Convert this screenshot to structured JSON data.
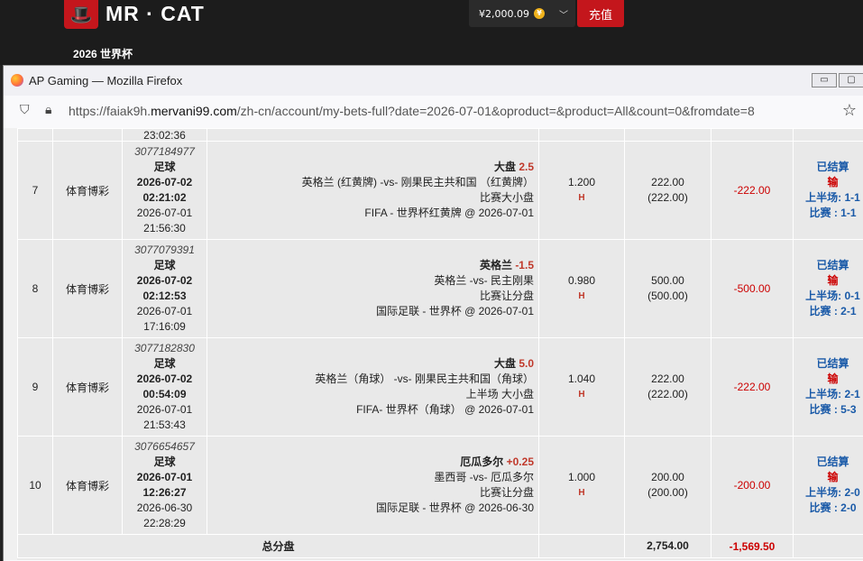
{
  "site": {
    "brand": "MR · CAT",
    "subnav": "2026 世界杯",
    "balance": "¥2,000.09",
    "coin_glyph": "¥",
    "deposit_label": "充值"
  },
  "browser": {
    "title": "AP Gaming — Mozilla Firefox",
    "url_prefix": "https://faiak9h.",
    "url_domain": "mervani99.com",
    "url_rest": "/zh-cn/account/my-bets-full?date=2026-07-01&oproduct=&product=All&count=0&fromdate=8"
  },
  "bets": {
    "prev_time_fragment": "23:02:36",
    "rows": [
      {
        "num": "7",
        "product": "体育博彩",
        "bet_id": "3077184977",
        "sport": "足球",
        "kick_date": "2026-07-02",
        "kick_time": "02:21:02",
        "place_date": "2026-07-01",
        "place_time": "21:56:30",
        "selection": "大盘",
        "handicap": "2.5",
        "match": "英格兰 (红黄牌) -vs- 刚果民主共和国 （红黄牌）",
        "market": "比赛大小盘",
        "league": "FIFA - 世界杯红黄牌 @ 2026-07-01",
        "odds": "1.200",
        "odds_type": "H",
        "stake": "222.00",
        "stake_paren": "(222.00)",
        "winloss": "-222.00",
        "status": "已结算",
        "result": "输",
        "half": "上半场: 1-1",
        "full": "比赛 : 1-1"
      },
      {
        "num": "8",
        "product": "体育博彩",
        "bet_id": "3077079391",
        "sport": "足球",
        "kick_date": "2026-07-02",
        "kick_time": "02:12:53",
        "place_date": "2026-07-01",
        "place_time": "17:16:09",
        "selection": "英格兰",
        "handicap": "-1.5",
        "match": "英格兰 -vs- 民主刚果",
        "market": "比赛让分盘",
        "league": "国际足联 - 世界杯 @ 2026-07-01",
        "odds": "0.980",
        "odds_type": "H",
        "stake": "500.00",
        "stake_paren": "(500.00)",
        "winloss": "-500.00",
        "status": "已结算",
        "result": "输",
        "half": "上半场: 0-1",
        "full": "比赛 : 2-1"
      },
      {
        "num": "9",
        "product": "体育博彩",
        "bet_id": "3077182830",
        "sport": "足球",
        "kick_date": "2026-07-02",
        "kick_time": "00:54:09",
        "place_date": "2026-07-01",
        "place_time": "21:53:43",
        "selection": "大盘",
        "handicap": "5.0",
        "match": "英格兰（角球） -vs- 刚果民主共和国（角球）",
        "market": "上半场 大小盘",
        "league": "FIFA- 世界杯（角球） @ 2026-07-01",
        "odds": "1.040",
        "odds_type": "H",
        "stake": "222.00",
        "stake_paren": "(222.00)",
        "winloss": "-222.00",
        "status": "已结算",
        "result": "输",
        "half": "上半场: 2-1",
        "full": "比赛 : 5-3"
      },
      {
        "num": "10",
        "product": "体育博彩",
        "bet_id": "3076654657",
        "sport": "足球",
        "kick_date": "2026-07-01",
        "kick_time": "12:26:27",
        "place_date": "2026-06-30",
        "place_time": "22:28:29",
        "selection": "厄瓜多尔",
        "handicap": "+0.25",
        "match": "墨西哥 -vs- 厄瓜多尔",
        "market": "比赛让分盘",
        "league": "国际足联 - 世界杯 @ 2026-06-30",
        "odds": "1.000",
        "odds_type": "H",
        "stake": "200.00",
        "stake_paren": "(200.00)",
        "winloss": "-200.00",
        "status": "已结算",
        "result": "输",
        "half": "上半场: 2-0",
        "full": "比赛 : 2-0"
      }
    ],
    "total": {
      "label": "总分盘",
      "stake": "2,754.00",
      "winloss": "-1,569.50"
    }
  },
  "colors": {
    "brand_red": "#c4161c",
    "loss_red": "#cc0000",
    "status_blue": "#1a5aa8",
    "handicap_red": "#c0392b"
  }
}
